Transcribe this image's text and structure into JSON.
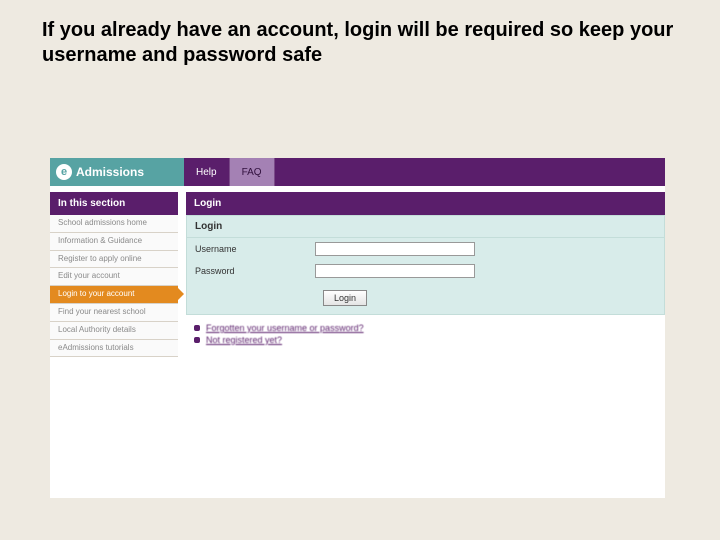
{
  "instruction": "If you already have an account, login will be required so keep your username and password safe",
  "brand": {
    "icon_letter": "e",
    "name": "Admissions"
  },
  "top_tabs": [
    {
      "label": "Help"
    },
    {
      "label": "FAQ"
    }
  ],
  "sidebar": {
    "heading": "In this section",
    "items": [
      {
        "label": "School admissions home",
        "active": false
      },
      {
        "label": "Information & Guidance",
        "active": false
      },
      {
        "label": "Register to apply online",
        "active": false
      },
      {
        "label": "Edit your account",
        "active": false
      },
      {
        "label": "Login to your account",
        "active": true
      },
      {
        "label": "Find your nearest school",
        "active": false
      },
      {
        "label": "Local Authority details",
        "active": false
      },
      {
        "label": "eAdmissions tutorials",
        "active": false
      }
    ]
  },
  "main": {
    "title": "Login",
    "panel_heading": "Login",
    "fields": {
      "username_label": "Username",
      "username_value": "",
      "password_label": "Password",
      "password_value": ""
    },
    "login_button": "Login",
    "links": [
      "Forgotten your username or password?",
      "Not registered yet?"
    ]
  }
}
